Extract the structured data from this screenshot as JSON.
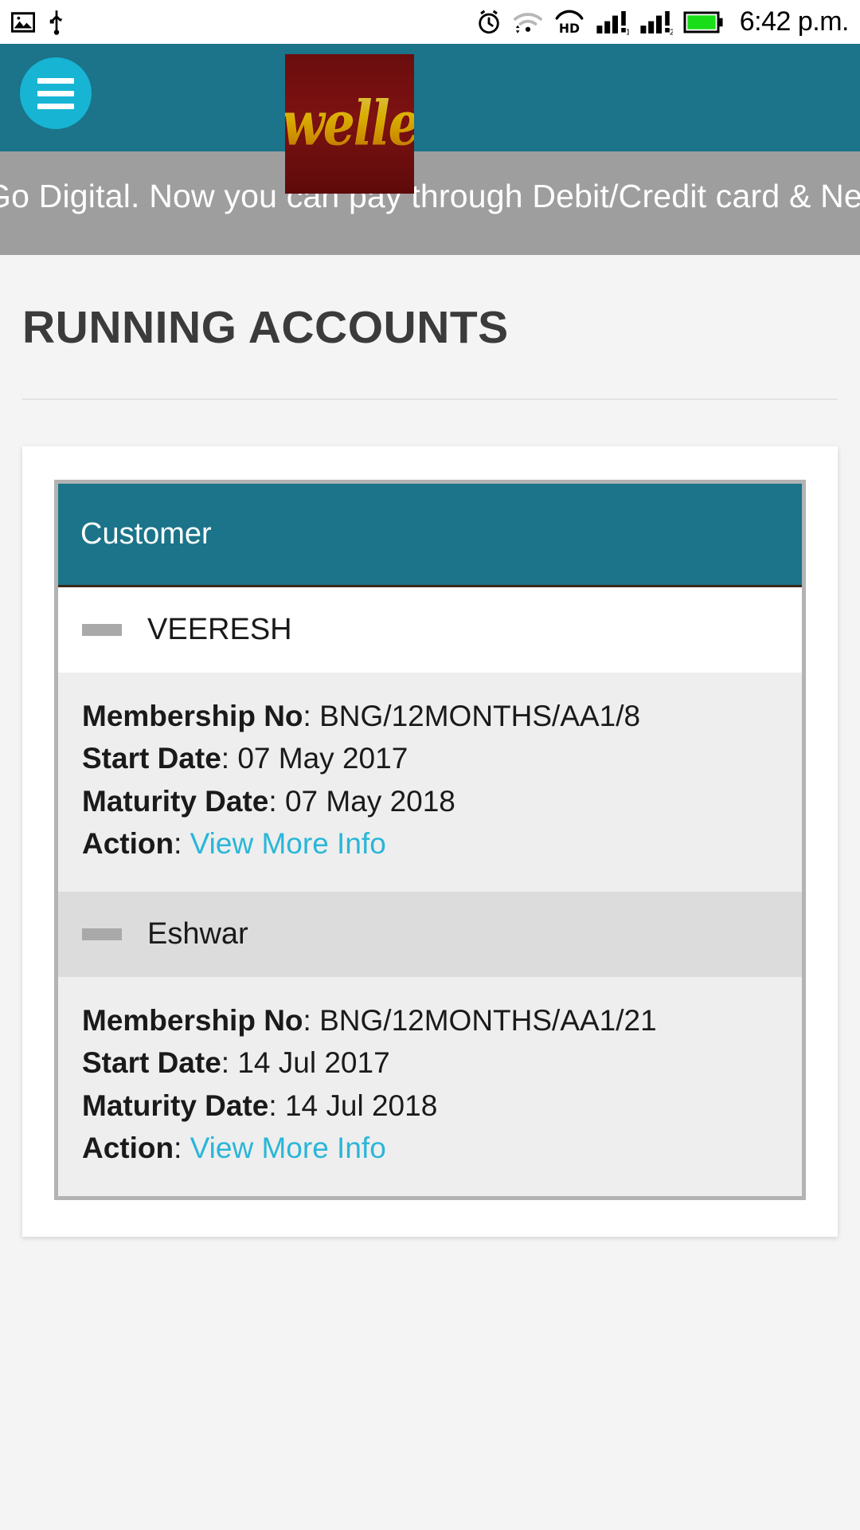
{
  "statusbar": {
    "time": "6:42 p.m.",
    "left_icons": [
      "image-icon",
      "usb-icon"
    ],
    "right_icons": [
      "alarm-icon",
      "wifi-icon",
      "hd-icon",
      "signal-1-icon",
      "signal-2-icon",
      "battery-icon"
    ],
    "battery_color": "#19dd19"
  },
  "header": {
    "menu_label": "menu",
    "logo_text": "Jewellers",
    "bg_color": "#1b7489",
    "menu_color": "#17b4d4",
    "logo_bg_color": "#6b0d0d",
    "logo_text_color": "#ffcc00"
  },
  "marquee": {
    "text": "Go Digital. Now you can pay through Debit/Credit card & Netbanking",
    "bg_color": "#9e9e9e"
  },
  "main": {
    "page_title": "RUNNING ACCOUNTS",
    "table": {
      "header": "Customer",
      "labels": {
        "membership": "Membership No",
        "start": "Start Date",
        "maturity": "Maturity Date",
        "action": "Action",
        "separator": ":"
      },
      "action_link": "View More Info",
      "link_color": "#29b6d8",
      "rows": [
        {
          "customer": "VEERESH",
          "membership_no": "BNG/12MONTHS/AA1/8",
          "start_date": "07 May 2017",
          "maturity_date": "07 May 2018",
          "action": "View More Info"
        },
        {
          "customer": "Eshwar",
          "membership_no": "BNG/12MONTHS/AA1/21",
          "start_date": "14 Jul 2017",
          "maturity_date": "14 Jul 2018",
          "action": "View More Info"
        }
      ]
    }
  }
}
